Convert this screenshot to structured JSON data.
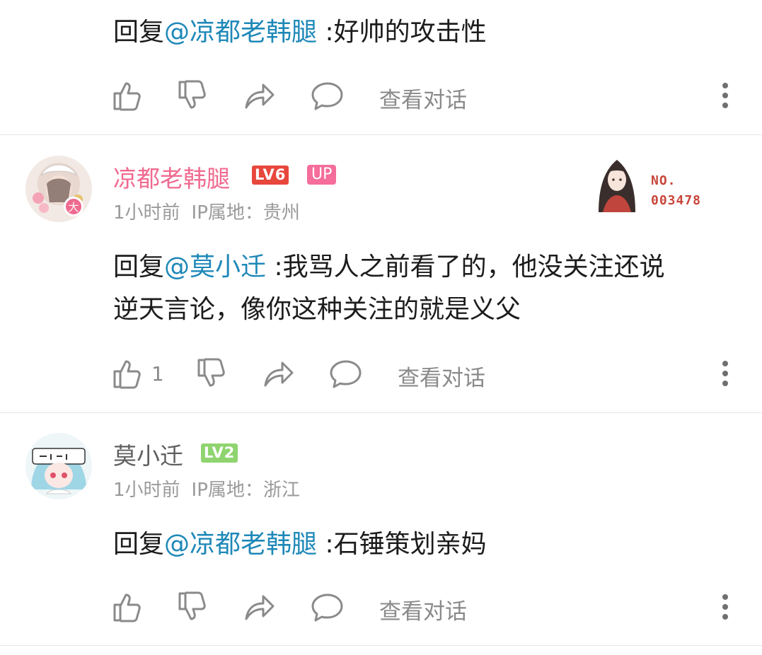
{
  "comments": [
    {
      "reply_prefix": "回复",
      "mention": "@凉都老韩腿",
      "text": " :好帅的攻击性",
      "actions": {
        "view_conversation": "查看对话",
        "likes": ""
      }
    },
    {
      "username": "凉都老韩腿",
      "username_color": "#f06a8f",
      "level": "LV6",
      "level_color": "#e8473c",
      "up_badge": "UP",
      "avatar_badge": "大",
      "time": "1小时前",
      "ip": "IP属地：贵州",
      "fan_card_label": "NO.",
      "fan_card_number": "003478",
      "reply_prefix": "回复",
      "mention": "@莫小迁",
      "text_line1": " :我骂人之前看了的，他没关注还说",
      "text_line2": "逆天言论，像你这种关注的就是义父",
      "actions": {
        "view_conversation": "查看对话",
        "likes": "1"
      }
    },
    {
      "username": "莫小迁",
      "username_color": "#5f5f5f",
      "level": "LV2",
      "level_color": "#8fd46e",
      "time": "1小时前",
      "ip": "IP属地：浙江",
      "reply_prefix": "回复",
      "mention": "@凉都老韩腿",
      "text": " :石锤策划亲妈",
      "actions": {
        "view_conversation": "查看对话",
        "likes": ""
      }
    }
  ],
  "icons": {
    "like": "thumbs-up-icon",
    "dislike": "thumbs-down-icon",
    "share": "share-arrow-icon",
    "reply": "speech-bubble-icon",
    "more": "more-vertical-icon"
  },
  "colors": {
    "mention": "#1e88b8",
    "secondary": "#9a9a9a",
    "divider": "#e7e7e7"
  }
}
